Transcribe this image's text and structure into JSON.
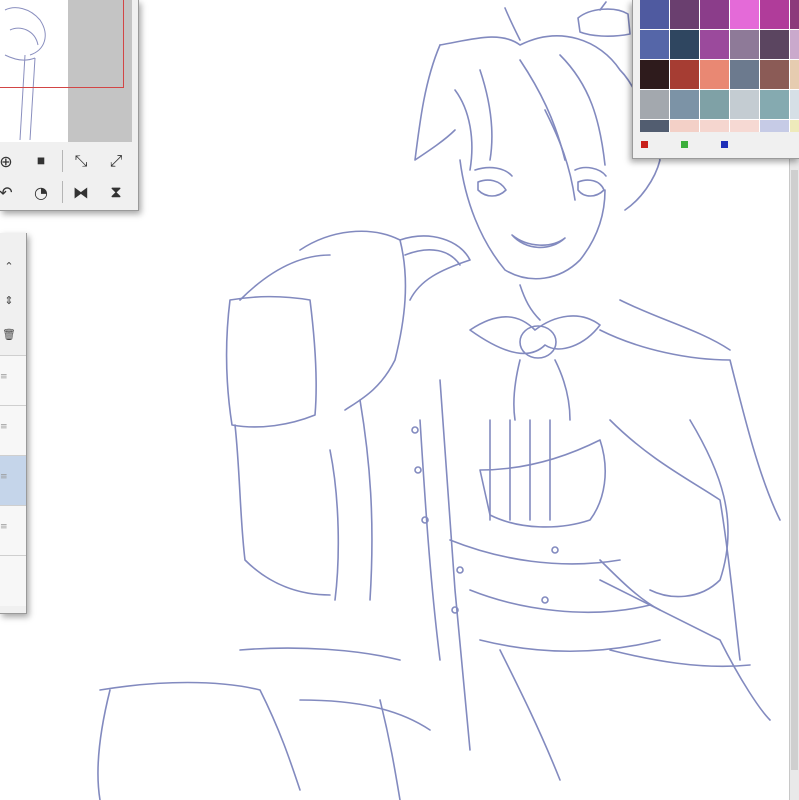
{
  "app": {
    "accent": "#5f69a8"
  },
  "canvas": {
    "background": "#ffffff",
    "stroke_color": "#6d76b4"
  },
  "navigator": {
    "buttons": [
      {
        "name": "zoom-in-icon",
        "glyph": "⊕"
      },
      {
        "name": "fit-icon",
        "glyph": "⏹"
      },
      {
        "name": "expand-icon",
        "glyph": "⤡"
      },
      {
        "name": "fullscreen-icon",
        "glyph": "⤢"
      },
      {
        "name": "rotate-left-icon",
        "glyph": "↶"
      },
      {
        "name": "reset-rotation-icon",
        "glyph": "◔"
      },
      {
        "name": "flip-horizontal-icon",
        "glyph": "⧓"
      },
      {
        "name": "flip-vertical-icon",
        "glyph": "⧗"
      }
    ]
  },
  "layers": {
    "tools": [
      {
        "name": "chevron-updown-icon",
        "glyph": "⌃"
      },
      {
        "name": "move-layer-icon",
        "glyph": "⇕"
      },
      {
        "name": "trash-icon",
        "glyph": "🗑"
      }
    ]
  },
  "colorset": {
    "swatches": [
      "#4f5aa0",
      "#6a3f6f",
      "#8b3d8a",
      "#e46ad8",
      "#b03c9a",
      "#8c3a7b",
      "#5566a8",
      "#2f4660",
      "#9b4a9c",
      "#8e7a98",
      "#5b4560",
      "#caa9cc",
      "#2e1b1c",
      "#a63d33",
      "#e98873",
      "#6c7a8e",
      "#8b5b56",
      "#e6ccb0",
      "#a3a8ae",
      "#7c93a6",
      "#7fa1a6",
      "#c4ccd2",
      "#85aab0",
      "#d6dfe6",
      "#525d70",
      "#f3d0c7",
      "#f5d6cf",
      "#f6d9d3",
      "#c6cbe6",
      "#eeeabb",
      "#fbf4b8",
      "#c3d3e6",
      "#fbf4c6",
      "#cfefe0",
      "#e9f3f8",
      "#f3f3f3"
    ],
    "rgb": [
      "#c8201b",
      "#3cae3b",
      "#1f2fb8"
    ]
  }
}
